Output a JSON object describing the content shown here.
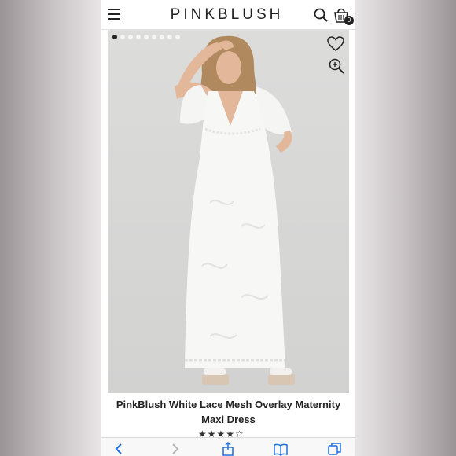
{
  "header": {
    "brand": "PINKBLUSH",
    "bag_count": "0"
  },
  "gallery": {
    "dot_count": 9,
    "active_index": 0
  },
  "product": {
    "title": "PinkBlush White Lace Mesh Overlay Maternity Maxi Dress",
    "rating_stars": "★★★★☆",
    "rating_value": 4.5
  },
  "toolbar": {
    "icons": [
      "back-icon",
      "forward-icon",
      "share-icon",
      "bookmarks-icon",
      "tabs-icon"
    ]
  },
  "colors": {
    "accent": "#222222",
    "browser_blue": "#1f6fe0"
  }
}
